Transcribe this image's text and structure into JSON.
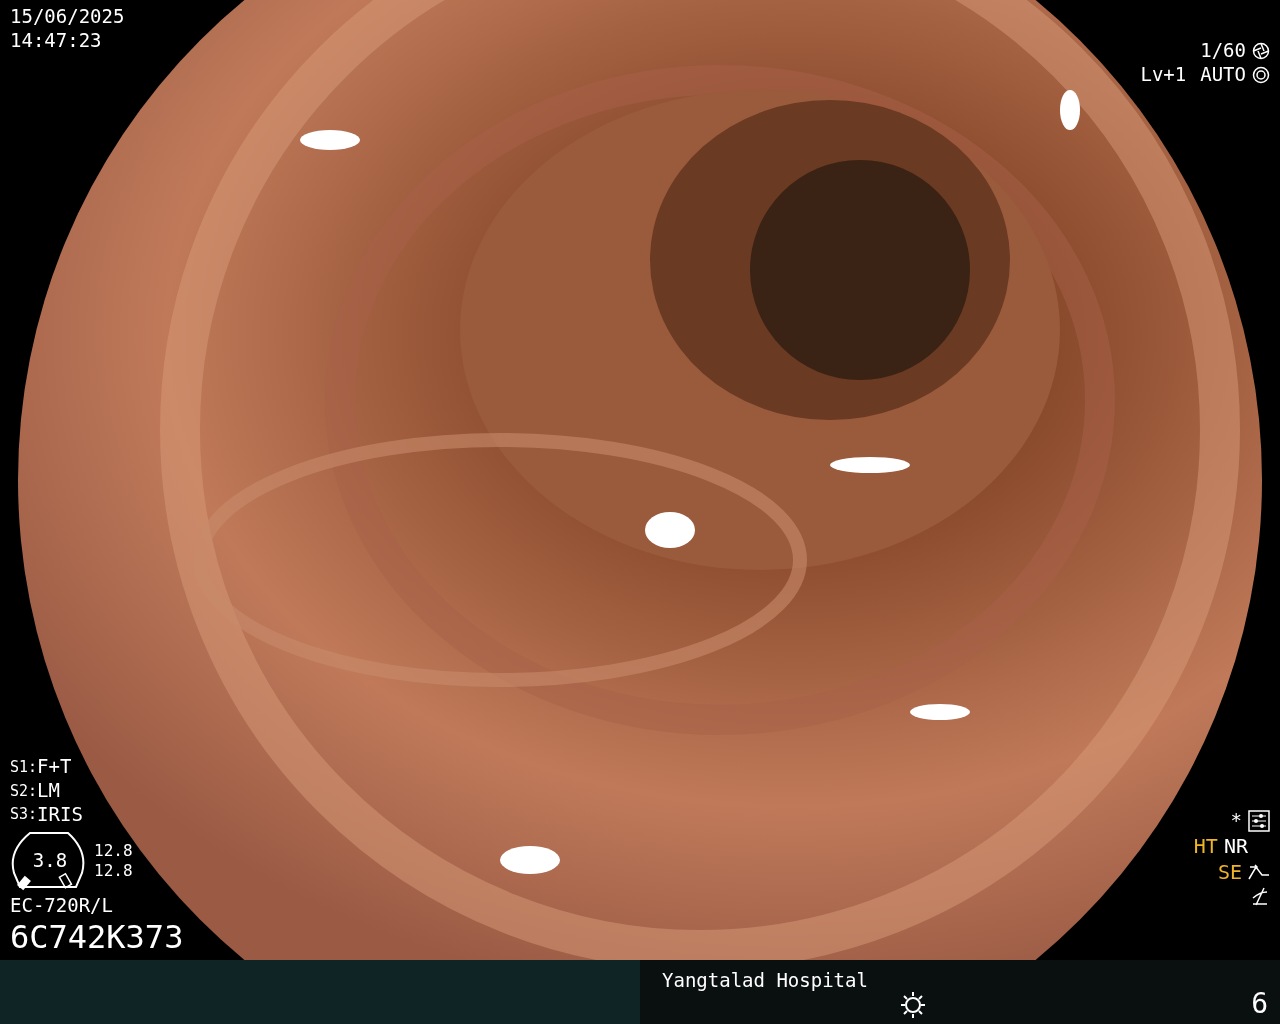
{
  "datetime": {
    "date": "15/06/2025",
    "time": "14:47:23"
  },
  "exposure": {
    "shutter": "1/60",
    "level": "Lv+1",
    "iris": "AUTO"
  },
  "scope_switches": [
    {
      "label": "S1:",
      "value": "F+T"
    },
    {
      "label": "S2:",
      "value": "LM"
    },
    {
      "label": "S3:",
      "value": "IRIS"
    }
  ],
  "gauge": {
    "value": "3.8",
    "readings": [
      "12.8",
      "12.8"
    ]
  },
  "scope": {
    "model": "EC-720R/L",
    "serial": "6C742K373"
  },
  "asterisk": "*",
  "processing": [
    {
      "label": "HT",
      "color": "#f0b428"
    },
    {
      "label": "NR",
      "color": "#ffffff"
    },
    {
      "label": "SE",
      "color": "#f0b428"
    }
  ],
  "footer": {
    "hospital": "Yangtalad Hospital",
    "number": "6"
  }
}
